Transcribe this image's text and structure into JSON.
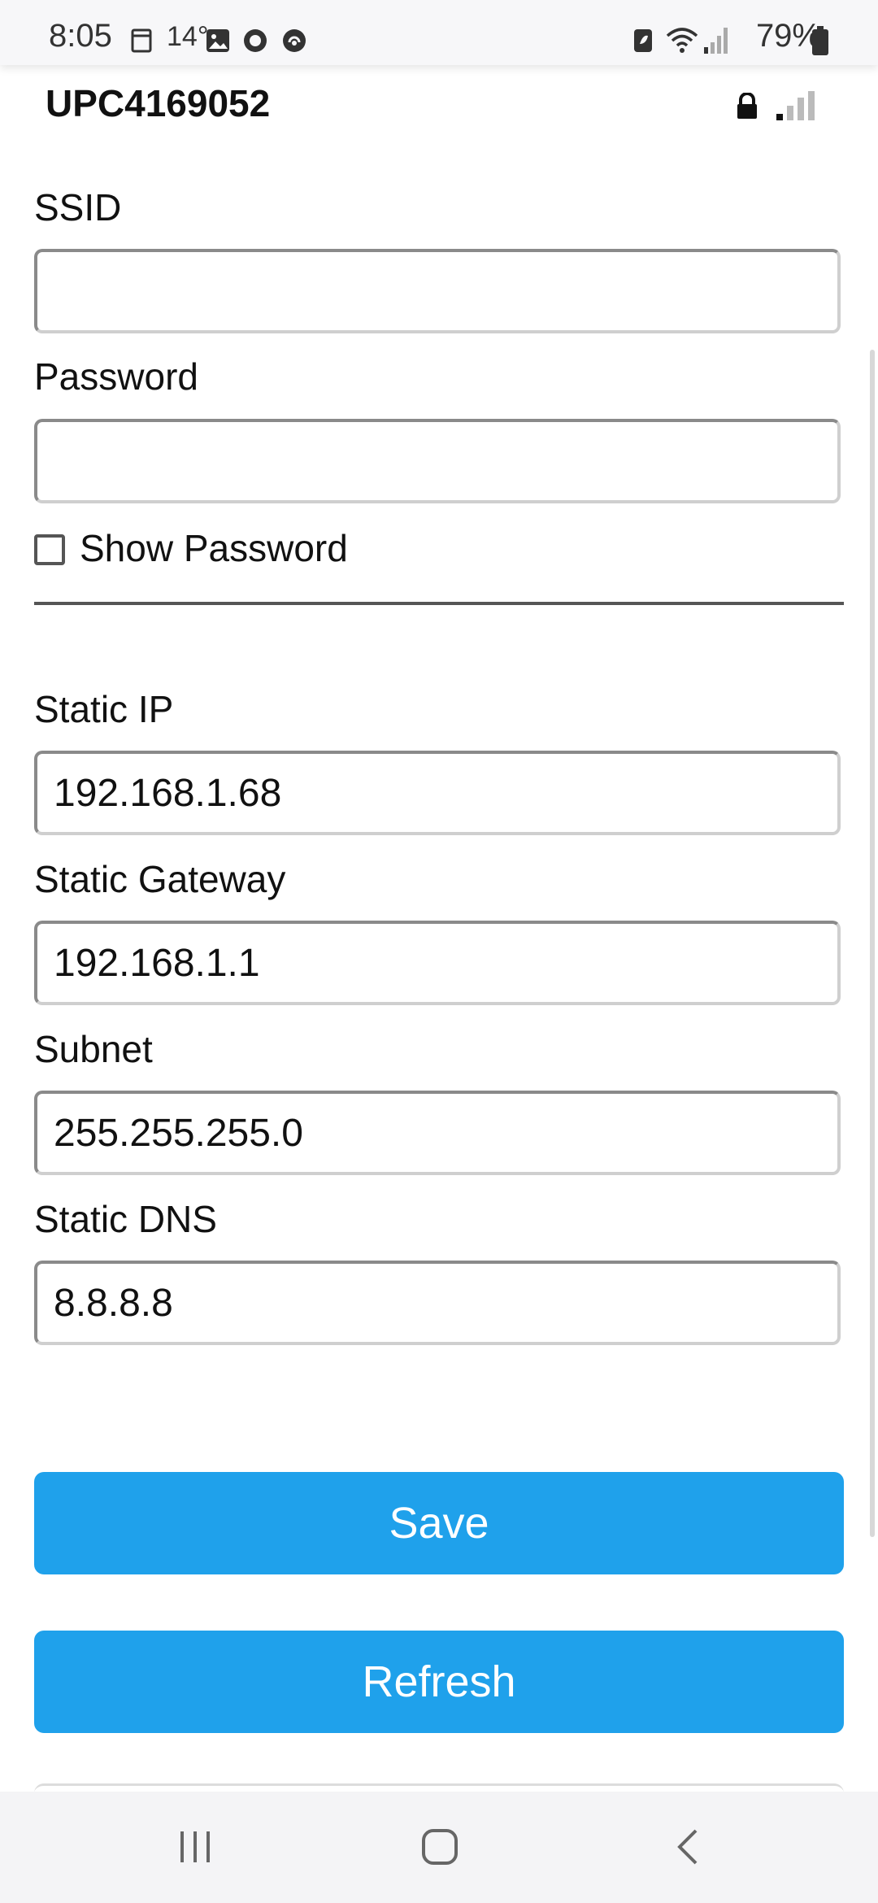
{
  "status_bar": {
    "time": "8:05",
    "temperature": "14°",
    "battery": "79%",
    "icons": [
      "notification-icon",
      "gallery-icon",
      "record-icon",
      "tracker-icon",
      "battery-saver-icon",
      "wifi-icon",
      "signal-icon",
      "battery-icon"
    ]
  },
  "network": {
    "name": "UPC4169052",
    "icons": [
      "lock-icon",
      "signal-strength-icon"
    ]
  },
  "form": {
    "ssid_label": "SSID",
    "ssid_value": "",
    "password_label": "Password",
    "password_value": "",
    "show_password_label": "Show Password",
    "show_password_checked": false,
    "static_ip_label": "Static IP",
    "static_ip_value": "192.168.1.68",
    "gateway_label": "Static Gateway",
    "gateway_value": "192.168.1.1",
    "subnet_label": "Subnet",
    "subnet_value": "255.255.255.0",
    "dns_label": "Static DNS",
    "dns_value": "8.8.8.8"
  },
  "buttons": {
    "save": "Save",
    "refresh": "Refresh"
  },
  "colors": {
    "accent": "#1fa1eb"
  },
  "nav": {
    "icons": [
      "recent-apps-icon",
      "home-icon",
      "back-icon"
    ]
  }
}
